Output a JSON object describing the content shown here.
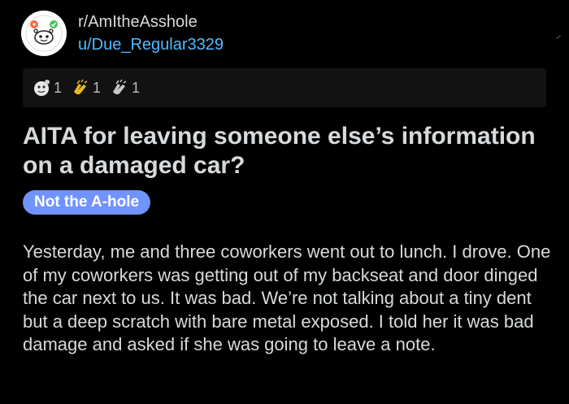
{
  "header": {
    "subreddit": "r/AmItheAsshole",
    "username": "u/Due_Regular3329",
    "avatar_icon": "reddit-snoo-icon"
  },
  "awards": [
    {
      "icon": "helpful-award-icon",
      "count": "1"
    },
    {
      "icon": "clapping-gold-award-icon",
      "count": "1"
    },
    {
      "icon": "clapping-silver-award-icon",
      "count": "1"
    }
  ],
  "post": {
    "title": "AITA for leaving someone else’s information on a damaged car?",
    "flair": "Not the A-hole",
    "body": "Yesterday, me and three coworkers went out to lunch. I drove. One of my coworkers was getting out of my backseat and door dinged the car next to us. It was bad. We’re not talking about a tiny dent but a deep scratch with bare metal exposed. I told her it was bad damage and asked if she was going to leave a note."
  },
  "colors": {
    "background": "#000000",
    "username": "#4fbcff",
    "flair_bg": "#7193ff",
    "text": "#d7dadc"
  }
}
